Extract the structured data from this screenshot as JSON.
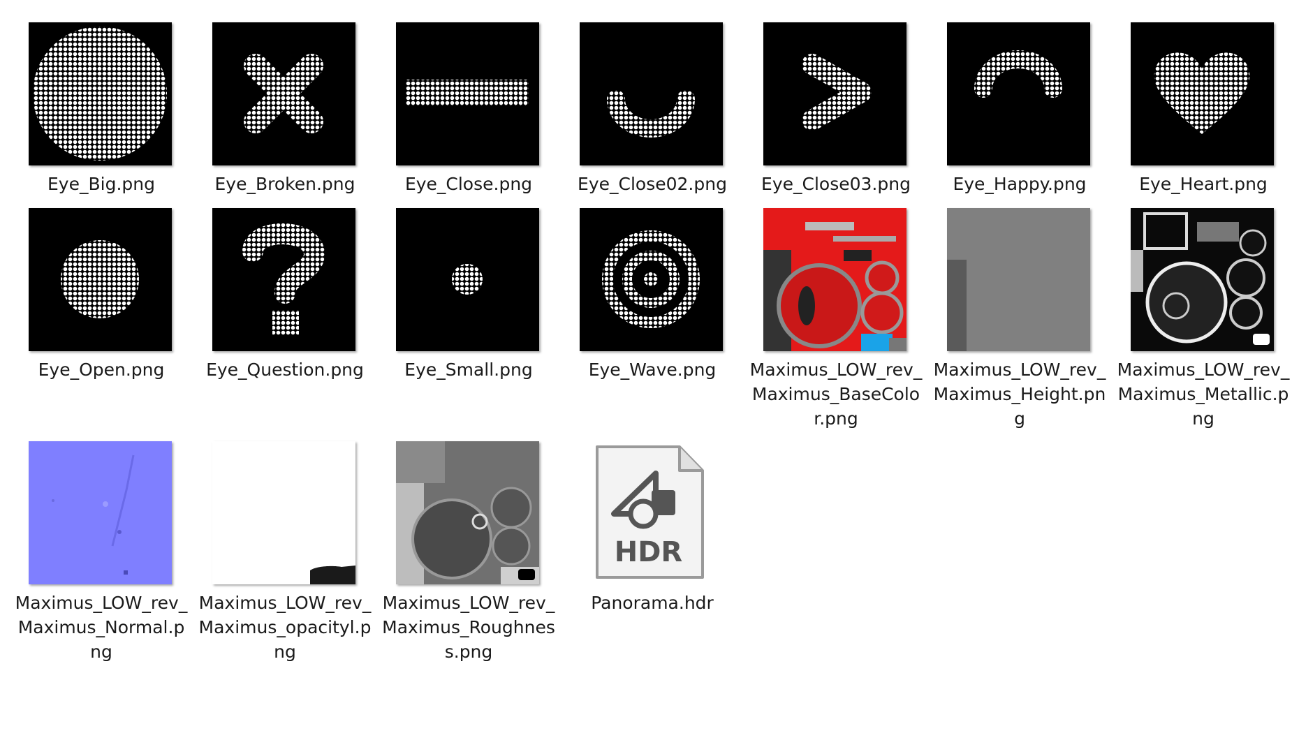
{
  "colors": {
    "background": "#ffffff",
    "text": "#1a1a1a",
    "thumb_black": "#000000",
    "dot_white": "#ffffff",
    "basecolor_red": "#e41a1a",
    "normal_blue": "#7f7fff",
    "hdr_icon_gray": "#555555"
  },
  "files": [
    {
      "name": "Eye_Big.png",
      "icon": "eye-big-thumbnail"
    },
    {
      "name": "Eye_Broken.png",
      "icon": "eye-broken-thumbnail"
    },
    {
      "name": "Eye_Close.png",
      "icon": "eye-close-thumbnail"
    },
    {
      "name": "Eye_Close02.png",
      "icon": "eye-close02-thumbnail"
    },
    {
      "name": "Eye_Close03.png",
      "icon": "eye-close03-thumbnail"
    },
    {
      "name": "Eye_Happy.png",
      "icon": "eye-happy-thumbnail"
    },
    {
      "name": "Eye_Heart.png",
      "icon": "eye-heart-thumbnail"
    },
    {
      "name": "Eye_Open.png",
      "icon": "eye-open-thumbnail"
    },
    {
      "name": "Eye_Question.png",
      "icon": "eye-question-thumbnail"
    },
    {
      "name": "Eye_Small.png",
      "icon": "eye-small-thumbnail"
    },
    {
      "name": "Eye_Wave.png",
      "icon": "eye-wave-thumbnail"
    },
    {
      "name": "Maximus_LOW_rev_Maximus_BaseColor.png",
      "icon": "basecolor-texture-thumbnail"
    },
    {
      "name": "Maximus_LOW_rev_Maximus_Height.png",
      "icon": "height-texture-thumbnail"
    },
    {
      "name": "Maximus_LOW_rev_Maximus_Metallic.png",
      "icon": "metallic-texture-thumbnail"
    },
    {
      "name": "Maximus_LOW_rev_Maximus_Normal.png",
      "icon": "normal-texture-thumbnail"
    },
    {
      "name": "Maximus_LOW_rev_Maximus_opacityl.png",
      "icon": "opacity-texture-thumbnail"
    },
    {
      "name": "Maximus_LOW_rev_Maximus_Roughness.png",
      "icon": "roughness-texture-thumbnail"
    },
    {
      "name": "Panorama.hdr",
      "icon": "hdr-file-icon",
      "badge": "HDR"
    }
  ]
}
